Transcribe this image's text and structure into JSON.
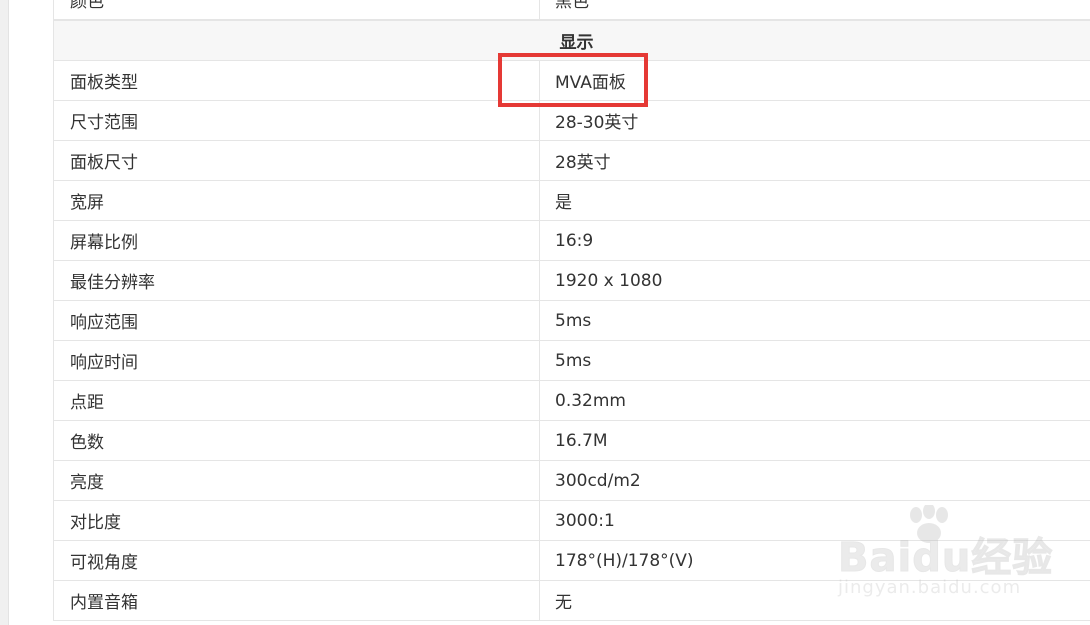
{
  "top_row": {
    "label": "颜色",
    "value": "黑色"
  },
  "section_title": "显示",
  "rows": [
    {
      "label": "面板类型",
      "value": "MVA面板"
    },
    {
      "label": "尺寸范围",
      "value": "28-30英寸"
    },
    {
      "label": "面板尺寸",
      "value": "28英寸"
    },
    {
      "label": "宽屏",
      "value": "是"
    },
    {
      "label": "屏幕比例",
      "value": "16:9"
    },
    {
      "label": "最佳分辨率",
      "value": "1920 x 1080"
    },
    {
      "label": "响应范围",
      "value": "5ms"
    },
    {
      "label": "响应时间",
      "value": "5ms"
    },
    {
      "label": "点距",
      "value": "0.32mm"
    },
    {
      "label": "色数",
      "value": "16.7M"
    },
    {
      "label": "亮度",
      "value": "300cd/m2"
    },
    {
      "label": "对比度",
      "value": "3000:1"
    },
    {
      "label": "可视角度",
      "value": "178°(H)/178°(V)"
    },
    {
      "label": "内置音箱",
      "value": "无"
    }
  ],
  "watermark": {
    "brand": "Baidu经验",
    "url": "jingyan.baidu.com"
  },
  "colors": {
    "highlight": "#e53935",
    "border": "#e5e5e5",
    "header_bg": "#f7f7f7"
  }
}
